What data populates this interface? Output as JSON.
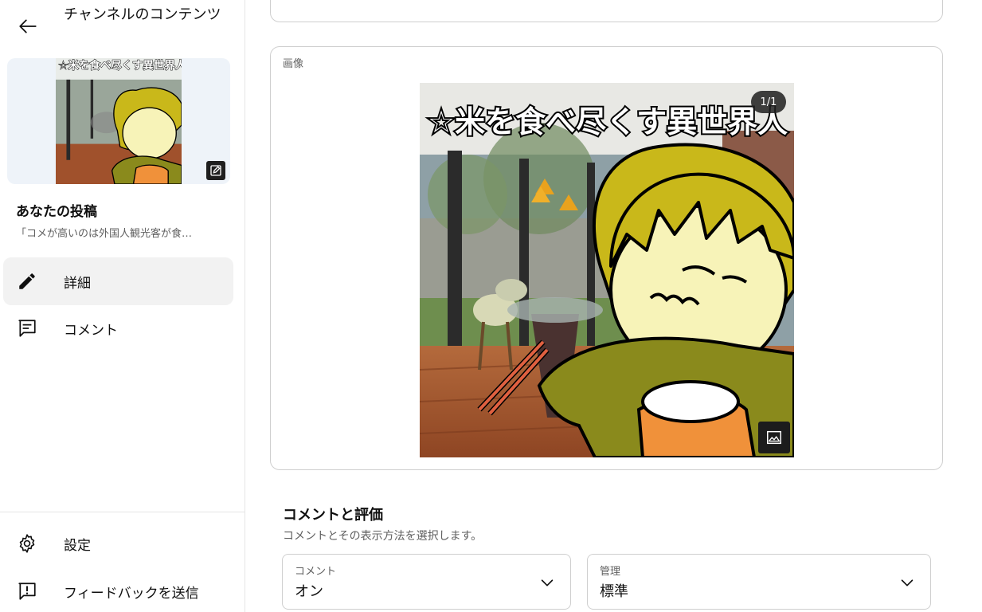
{
  "sidebar": {
    "title": "チャンネルのコンテンツ",
    "your_post_label": "あなたの投稿",
    "post_excerpt": "「コメが高いのは外国人観光客が食…",
    "thumbnail_caption": "☆米を食べ尽くす異世界人",
    "nav": [
      {
        "label": "詳細",
        "icon": "pencil-icon",
        "active": true
      },
      {
        "label": "コメント",
        "icon": "comment-icon",
        "active": false
      }
    ],
    "bottom_nav": [
      {
        "label": "設定",
        "icon": "gear-icon"
      },
      {
        "label": "フィードバックを送信",
        "icon": "feedback-icon"
      }
    ]
  },
  "image_section": {
    "label": "画像",
    "page_indicator": "1/1",
    "image_caption": "☆米を食べ尽くす異世界人"
  },
  "comments_section": {
    "title": "コメントと評価",
    "description": "コメントとその表示方法を選択します。",
    "comment_select": {
      "label": "コメント",
      "value": "オン"
    },
    "moderation_select": {
      "label": "管理",
      "value": "標準"
    }
  },
  "colors": {
    "hair": "#c9b81a",
    "shirt": "#8a8a1c",
    "bowl": "#f0913a",
    "floor": "#a0512c"
  }
}
